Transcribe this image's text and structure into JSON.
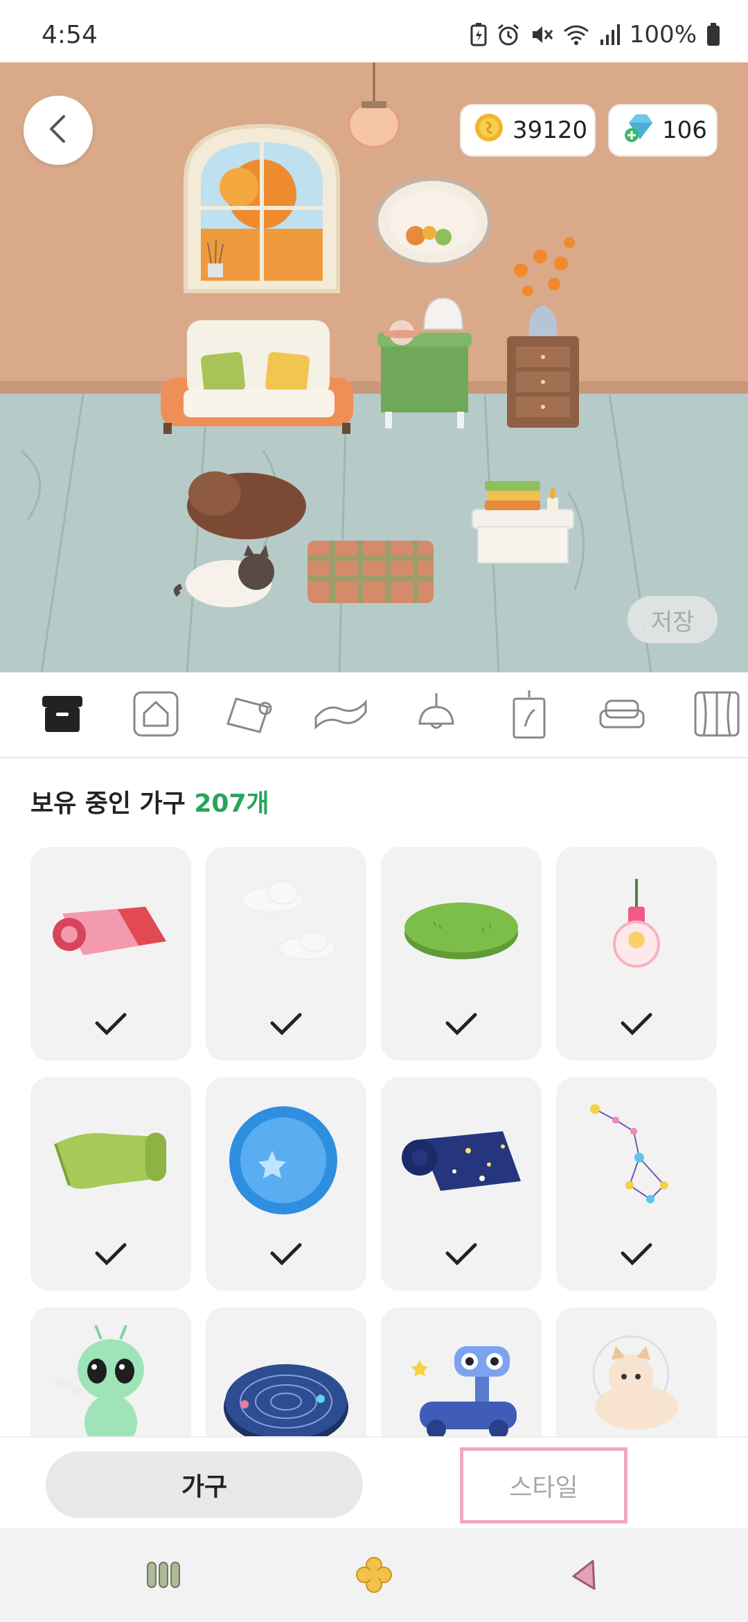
{
  "status_bar": {
    "time": "4:54",
    "battery": "100%",
    "icons": [
      "battery-saver-icon",
      "alarm-icon",
      "mute-icon",
      "wifi-icon",
      "signal-icon",
      "battery-icon"
    ]
  },
  "room": {
    "coins": "39120",
    "gems": "106",
    "save_label": "저장"
  },
  "category_tabs": [
    {
      "icon": "storage-box-icon",
      "selected": true
    },
    {
      "icon": "house-icon",
      "selected": false
    },
    {
      "icon": "wallpaper-roll-icon",
      "selected": false
    },
    {
      "icon": "floor-rug-icon",
      "selected": false
    },
    {
      "icon": "ceiling-lamp-icon",
      "selected": false
    },
    {
      "icon": "wall-frame-icon",
      "selected": false
    },
    {
      "icon": "sofa-icon",
      "selected": false
    },
    {
      "icon": "window-curtain-icon",
      "selected": false
    }
  ],
  "owned": {
    "label": "보유 중인 가구",
    "count": "207개"
  },
  "items": [
    {
      "icon": "pink-rug-icon",
      "checked": true
    },
    {
      "icon": "clouds-icon",
      "checked": true
    },
    {
      "icon": "green-mat-icon",
      "checked": true
    },
    {
      "icon": "pink-bulb-icon",
      "checked": true
    },
    {
      "icon": "green-roll-rug-icon",
      "checked": true
    },
    {
      "icon": "blue-globe-icon",
      "checked": true
    },
    {
      "icon": "starry-blanket-icon",
      "checked": true
    },
    {
      "icon": "constellation-icon",
      "checked": true
    },
    {
      "icon": "alien-icon",
      "checked": false
    },
    {
      "icon": "galaxy-rug-icon",
      "checked": false
    },
    {
      "icon": "robot-icon",
      "checked": false
    },
    {
      "icon": "astronaut-cat-icon",
      "checked": false
    }
  ],
  "bottom": {
    "furniture_label": "가구",
    "style_label": "스타일"
  },
  "colors": {
    "accent_green": "#27a55a",
    "style_outline": "#f0a7c3",
    "wall": "#d9a98a",
    "floor": "#b6cbc8"
  }
}
